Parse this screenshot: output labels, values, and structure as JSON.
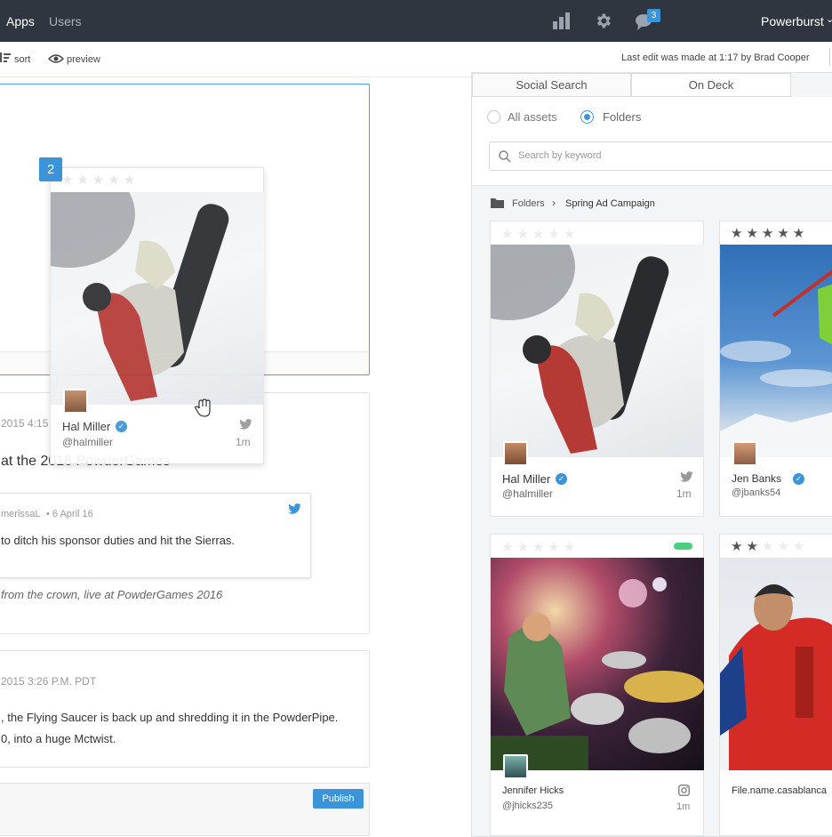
{
  "nav": {
    "apps": "Apps",
    "users": "Users",
    "account": "Powerburst",
    "notifications_count": "3"
  },
  "toolbar": {
    "sort": "sort",
    "preview": "preview",
    "last_edit": "Last edit was made at 1:17 by Brad Cooper"
  },
  "drag_card": {
    "badge": "2",
    "name": "Hal Miller",
    "handle": "@halmiller",
    "time": "1m"
  },
  "post1": {
    "date": "2015 4:15",
    "title": "at the 2016 PowderGames",
    "tweet_author": "merissaL",
    "tweet_date": "• 6 April 16",
    "tweet_text": "to ditch his sponsor duties and hit the Sierras.",
    "caption": "from the crown, live at PowderGames 2016"
  },
  "post2": {
    "date": "2015 3:26 P.M. PDT",
    "line1": ", the Flying Saucer is back up and shredding it in the PowderPipe.",
    "line2": "0, into a huge Mctwist."
  },
  "publish": "Publish",
  "panel": {
    "tabs": [
      "Social Search",
      "On Deck"
    ],
    "radio_all": "All assets",
    "radio_folders": "Folders",
    "search_placeholder": "Search by keyword",
    "breadcrumb_root": "Folders",
    "breadcrumb_current": "Spring Ad Campaign",
    "cards": [
      {
        "name": "Hal Miller",
        "handle": "@halmiller",
        "time": "1m",
        "rating": 0
      },
      {
        "name": "Jen Banks",
        "handle": "@jbanks54",
        "rating": 5
      },
      {
        "name": "Jennifer Hicks",
        "handle": "@jhicks235",
        "time": "1m",
        "rating": 0
      },
      {
        "name": "File.name.casablanca",
        "rating": 2
      }
    ]
  },
  "colors": {
    "accent": "#3c94d8",
    "topbar": "#2f3640",
    "status_green": "#4cd07d"
  }
}
